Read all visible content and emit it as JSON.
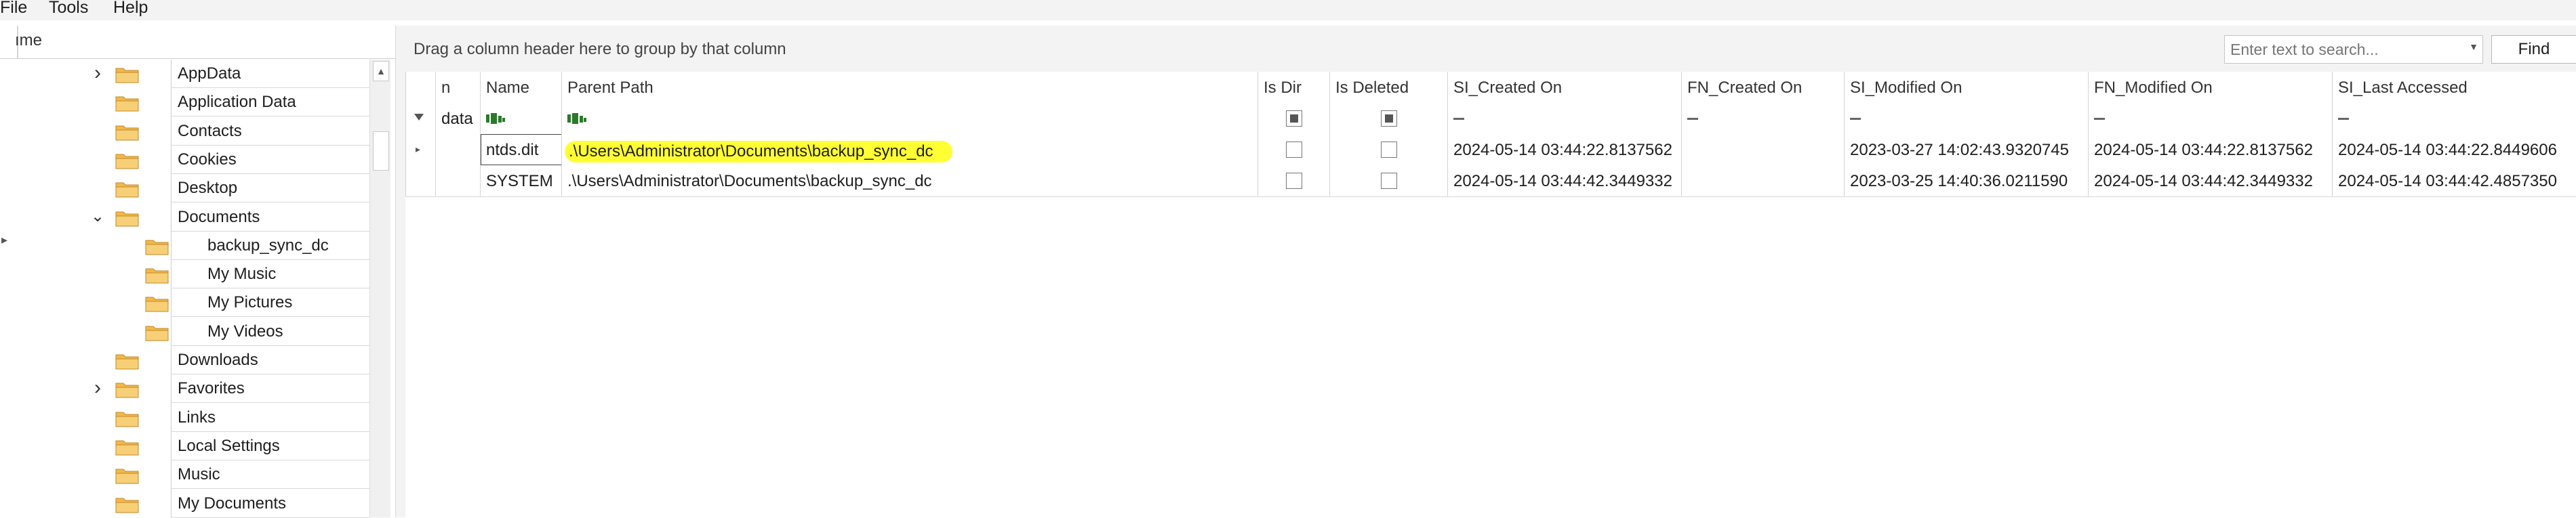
{
  "menu": {
    "file": "File",
    "tools": "Tools",
    "help": "Help"
  },
  "tree": {
    "header": "ıme",
    "items": [
      {
        "label": "AppData",
        "expander": "›",
        "level": 1
      },
      {
        "label": "Application Data",
        "expander": "",
        "level": 1
      },
      {
        "label": "Contacts",
        "expander": "",
        "level": 1
      },
      {
        "label": "Cookies",
        "expander": "",
        "level": 1
      },
      {
        "label": "Desktop",
        "expander": "",
        "level": 1
      },
      {
        "label": "Documents",
        "expander": "⌄",
        "level": 1
      },
      {
        "label": "backup_sync_dc",
        "expander": "",
        "level": 2
      },
      {
        "label": "My Music",
        "expander": "",
        "level": 2
      },
      {
        "label": "My Pictures",
        "expander": "",
        "level": 2
      },
      {
        "label": "My Videos",
        "expander": "",
        "level": 2
      },
      {
        "label": "Downloads",
        "expander": "",
        "level": 1
      },
      {
        "label": "Favorites",
        "expander": "›",
        "level": 1
      },
      {
        "label": "Links",
        "expander": "",
        "level": 1
      },
      {
        "label": "Local Settings",
        "expander": "",
        "level": 1
      },
      {
        "label": "Music",
        "expander": "",
        "level": 1
      },
      {
        "label": "My Documents",
        "expander": "",
        "level": 1
      }
    ]
  },
  "groupbar": {
    "hint": "Drag a column header here to group by that column",
    "search_placeholder": "Enter text to search...",
    "find": "Find"
  },
  "grid": {
    "columns": [
      "n",
      "Name",
      "Parent Path",
      "Is Dir",
      "Is Deleted",
      "SI_Created On",
      "FN_Created On",
      "SI_Modified On",
      "FN_Modified On",
      "SI_Last Accessed"
    ],
    "filter_first": "data",
    "rows": [
      {
        "name": "ntds.dit",
        "parent_path": ".\\Users\\Administrator\\Documents\\backup_sync_dc",
        "is_dir": false,
        "is_deleted": false,
        "si_created": "2024-05-14 03:44:22.8137562",
        "fn_created": "",
        "si_modified": "2023-03-27 14:02:43.9320745",
        "fn_modified": "2024-05-14 03:44:22.8137562",
        "si_last_accessed": "2024-05-14 03:44:22.8449606",
        "highlighted": true
      },
      {
        "name": "SYSTEM",
        "parent_path": ".\\Users\\Administrator\\Documents\\backup_sync_dc",
        "is_dir": false,
        "is_deleted": false,
        "si_created": "2024-05-14 03:44:42.3449332",
        "fn_created": "",
        "si_modified": "2023-03-25 14:40:36.0211590",
        "fn_modified": "2024-05-14 03:44:42.3449332",
        "si_last_accessed": "2024-05-14 03:44:42.4857350",
        "highlighted": false
      }
    ]
  },
  "colors": {
    "highlight": "#ffff33",
    "folder": "#f2b84b"
  }
}
